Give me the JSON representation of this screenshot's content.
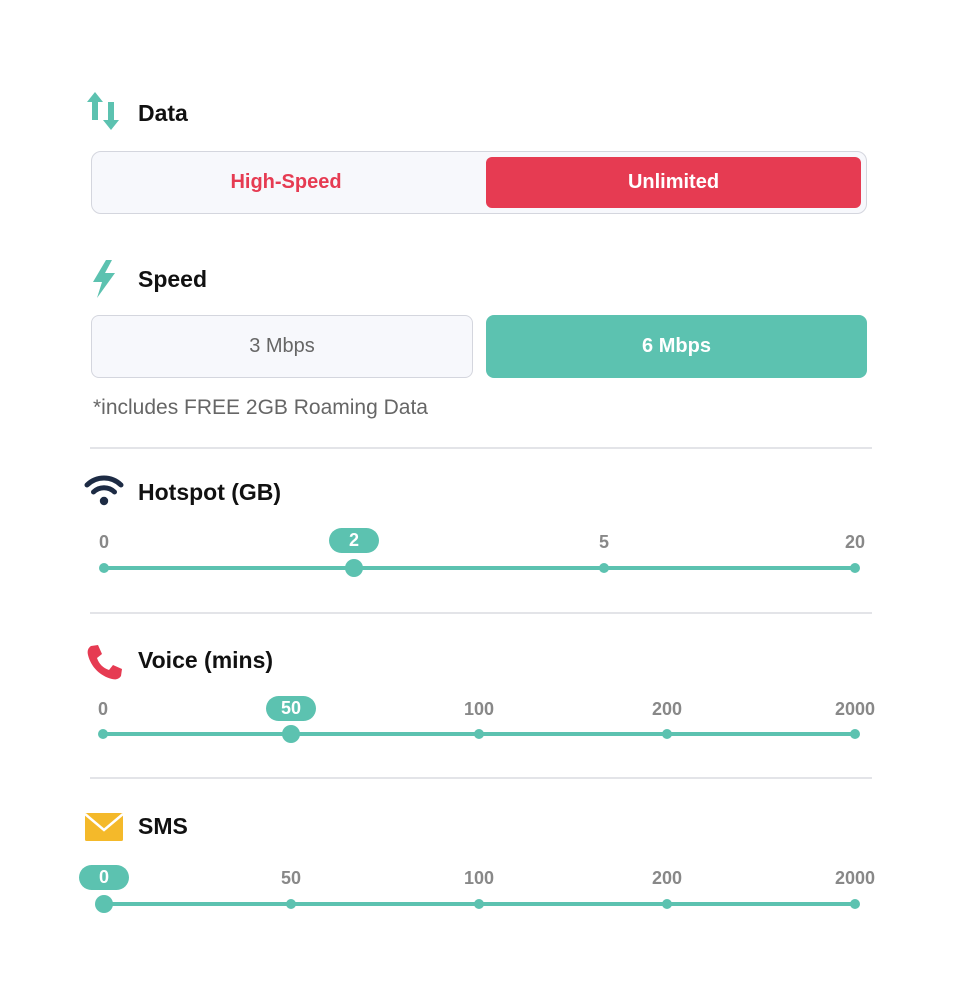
{
  "data": {
    "title": "Data",
    "options": [
      "High-Speed",
      "Unlimited"
    ],
    "selected": "Unlimited",
    "accent": "#e63b52"
  },
  "speed": {
    "title": "Speed",
    "options": [
      "3 Mbps",
      "6 Mbps"
    ],
    "selected": "6 Mbps",
    "note": "*includes FREE 2GB Roaming Data",
    "accent": "#5cc2b0"
  },
  "hotspot": {
    "title": "Hotspot (GB)",
    "ticks": [
      "0",
      "2",
      "5",
      "20"
    ],
    "value": "2"
  },
  "voice": {
    "title": "Voice (mins)",
    "ticks": [
      "0",
      "50",
      "100",
      "200",
      "2000"
    ],
    "value": "50"
  },
  "sms": {
    "title": "SMS",
    "ticks": [
      "0",
      "50",
      "100",
      "200",
      "2000"
    ],
    "value": "0"
  },
  "icons": {
    "data": "up-down-arrows-icon",
    "speed": "lightning-bolt-icon",
    "hotspot": "wifi-icon",
    "voice": "phone-icon",
    "sms": "envelope-icon"
  },
  "colors": {
    "teal": "#5cc2b0",
    "red": "#e63b52",
    "navy": "#1d2b44",
    "yellow": "#f4b92a"
  }
}
